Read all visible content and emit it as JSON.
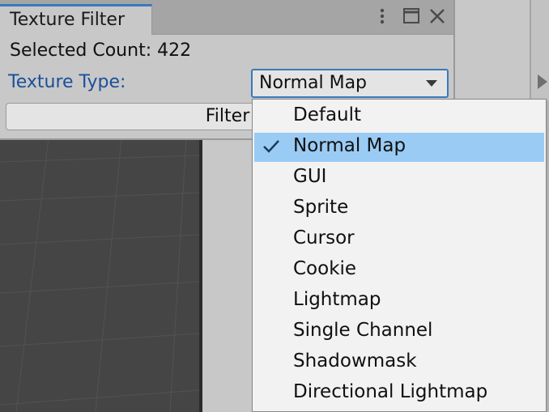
{
  "window": {
    "tab_title": "Texture Filter"
  },
  "content": {
    "selected_count_label": "Selected Count: 422",
    "texture_type_label": "Texture Type:",
    "texture_type_value": "Normal Map",
    "filter_button_label": "Filter"
  },
  "menu": {
    "items": [
      {
        "label": "Default",
        "selected": false
      },
      {
        "label": "Normal Map",
        "selected": true
      },
      {
        "label": "GUI",
        "selected": false
      },
      {
        "label": "Sprite",
        "selected": false
      },
      {
        "label": "Cursor",
        "selected": false
      },
      {
        "label": "Cookie",
        "selected": false
      },
      {
        "label": "Lightmap",
        "selected": false
      },
      {
        "label": "Single Channel",
        "selected": false
      },
      {
        "label": "Shadowmask",
        "selected": false
      },
      {
        "label": "Directional Lightmap",
        "selected": false
      }
    ]
  },
  "colors": {
    "accent": "#3a79bb",
    "label_blue": "#1b4f9a",
    "selection": "#9acbf4"
  }
}
